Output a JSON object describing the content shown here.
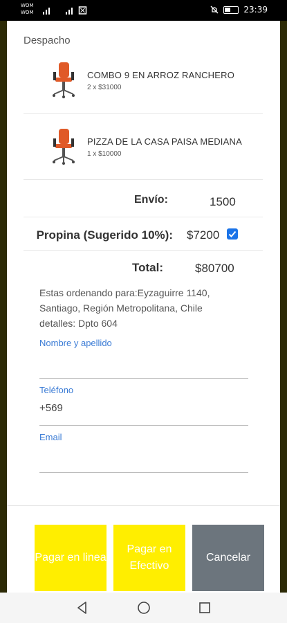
{
  "status_bar": {
    "carrier_line1": "WOM",
    "carrier_line2": "WOM",
    "time": "23:39"
  },
  "section_title": "Despacho",
  "items": [
    {
      "name": "COMBO 9 EN ARROZ RANCHERO",
      "qty": "2 x $31000",
      "icon": "office-chair-icon"
    },
    {
      "name": "PIZZA DE LA CASA PAISA MEDIANA",
      "qty": "1 x $10000",
      "icon": "office-chair-icon"
    }
  ],
  "summary": {
    "shipping_label": "Envío:",
    "shipping_value": "1500",
    "tip_label": "Propina (Sugerido 10%):",
    "tip_value": "$7200",
    "tip_checked": true,
    "total_label": "Total:",
    "total_value": "$80700"
  },
  "order_for": {
    "line1": "Estas ordenando para:Eyzaguirre 1140,",
    "line2": "Santiago, Región Metropolitana, Chile",
    "line3": "detalles: Dpto 604"
  },
  "form": {
    "name_label": "Nombre y apellido",
    "name_value": "",
    "phone_label": "Teléfono",
    "phone_value": "+569",
    "email_label": "Email",
    "email_value": ""
  },
  "buttons": {
    "pay_online": "Pagar en linea",
    "pay_cash": "Pagar en Efectivo",
    "cancel": "Cancelar"
  },
  "colors": {
    "accent_blue": "#1a73e8",
    "button_yellow": "#ffee00",
    "button_gray": "#6c757d",
    "backdrop": "#2c2a06"
  }
}
